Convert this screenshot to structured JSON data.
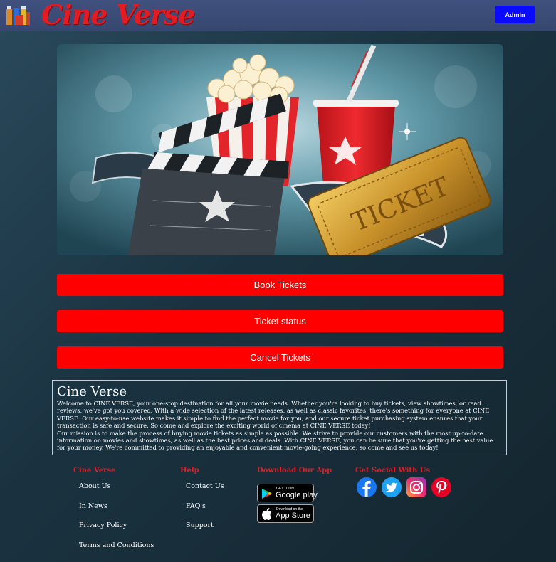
{
  "brand": {
    "name": "Cine Verse"
  },
  "header": {
    "admin_label": "Admin"
  },
  "actions": {
    "book": "Book Tickets",
    "status": "Ticket status",
    "cancel": "Cancel Tickets"
  },
  "about": {
    "title": "Cine Verse",
    "paragraph1": "Welcome to CINE VERSE, your one-stop destination for all your movie needs. Whether you're looking to buy tickets, view showtimes, or read reviews, we've got you covered. With a wide selection of the latest releases, as well as classic favorites, there's something for everyone at CINE VERSE. Our easy-to-use website makes it simple to find the perfect movie for you, and our secure ticket purchasing system ensures that your transaction is safe and secure. So come and explore the exciting world of cinema at CINE VERSE today!",
    "paragraph2": "Our mission is to make the process of buying movie tickets as simple as possible. We strive to provide our customers with the most up-to-date information on movies and showtimes, as well as the best prices and deals. With CINE VERSE, you can be sure that you're getting the best value for your money. We're committed to providing an enjoyable and convenient movie-going experience, so come and see us today!"
  },
  "footer": {
    "col1": {
      "title": "Cine Verse",
      "links": [
        "About Us",
        "In News",
        "Privacy Policy",
        "Terms and Conditions"
      ]
    },
    "col2": {
      "title": "Help",
      "links": [
        "Contact Us",
        "FAQ's",
        "Support"
      ]
    },
    "col3": {
      "title": "Download Our App",
      "google_small": "GET IT ON",
      "google_big": "Google play",
      "apple_small": "Download on the",
      "apple_big": "App Store"
    },
    "col4": {
      "title": "Get Social With Us",
      "icons": [
        "facebook-icon",
        "twitter-icon",
        "instagram-icon",
        "pinterest-icon"
      ]
    }
  },
  "hero": {
    "ticket_text": "TICKET"
  },
  "colors": {
    "accent": "#ff0000",
    "brand": "#e41b23",
    "admin": "#0a0aff",
    "navbar": "#3b4b76"
  }
}
